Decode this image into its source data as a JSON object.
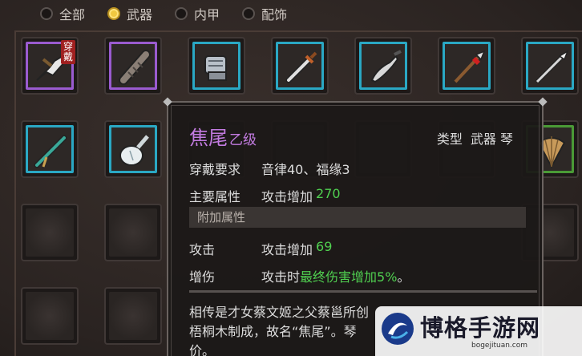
{
  "tabs": [
    {
      "label": "全部",
      "selected": false
    },
    {
      "label": "武器",
      "selected": true
    },
    {
      "label": "内甲",
      "selected": false
    },
    {
      "label": "配饰",
      "selected": false
    }
  ],
  "slots": {
    "r1": [
      {
        "icon": "cleaver-weapon-icon",
        "rarity": "purple",
        "equipped": true
      },
      {
        "icon": "wrapped-scroll-weapon-icon",
        "rarity": "purple",
        "equipped": false
      },
      {
        "icon": "gauntlet-icon",
        "rarity": "cyan",
        "equipped": false
      },
      {
        "icon": "sword-icon",
        "rarity": "cyan",
        "equipped": false
      },
      {
        "icon": "broadsword-icon",
        "rarity": "cyan",
        "equipped": false
      },
      {
        "icon": "red-tassel-spear-icon",
        "rarity": "cyan",
        "equipped": false
      },
      {
        "icon": "spear-icon",
        "rarity": "cyan",
        "equipped": false
      }
    ],
    "r2": [
      {
        "icon": "jade-flute-icon",
        "rarity": "cyan"
      },
      {
        "icon": "pipa-lute-icon",
        "rarity": "cyan"
      }
    ]
  },
  "equip_badge": "穿戴",
  "tooltip": {
    "name": "焦尾",
    "grade": "乙级",
    "type_label": "类型",
    "type_value": "武器 琴",
    "requirement_label": "穿戴要求",
    "requirement_value": "音律40、福缘3",
    "main_attr_label": "主要属性",
    "main_attr_prefix": "攻击增加",
    "main_attr_value": "270",
    "extra_header": "附加属性",
    "extra1_label": "攻击",
    "extra1_prefix": "攻击增加",
    "extra1_value": "69",
    "extra2_label": "增伤",
    "extra2_prefix": "攻击时",
    "extra2_value": "最终伤害增加5%",
    "extra2_suffix": "。",
    "desc_line1": "相传是才女蔡文姬之父蔡邕所创",
    "desc_line2": "梧桐木制成，故名“焦尾”。琴",
    "desc_line3": "价。"
  },
  "watermark": {
    "text": "博格手游网",
    "url": "bogejituan.com"
  },
  "colors": {
    "purple_rarity": "#9a5bd0",
    "cyan_rarity": "#2aa8c4",
    "green_rarity": "#4a9a36",
    "item_name": "#c27be0",
    "bonus_green": "#50d050",
    "tab_active": "#f0c840"
  }
}
